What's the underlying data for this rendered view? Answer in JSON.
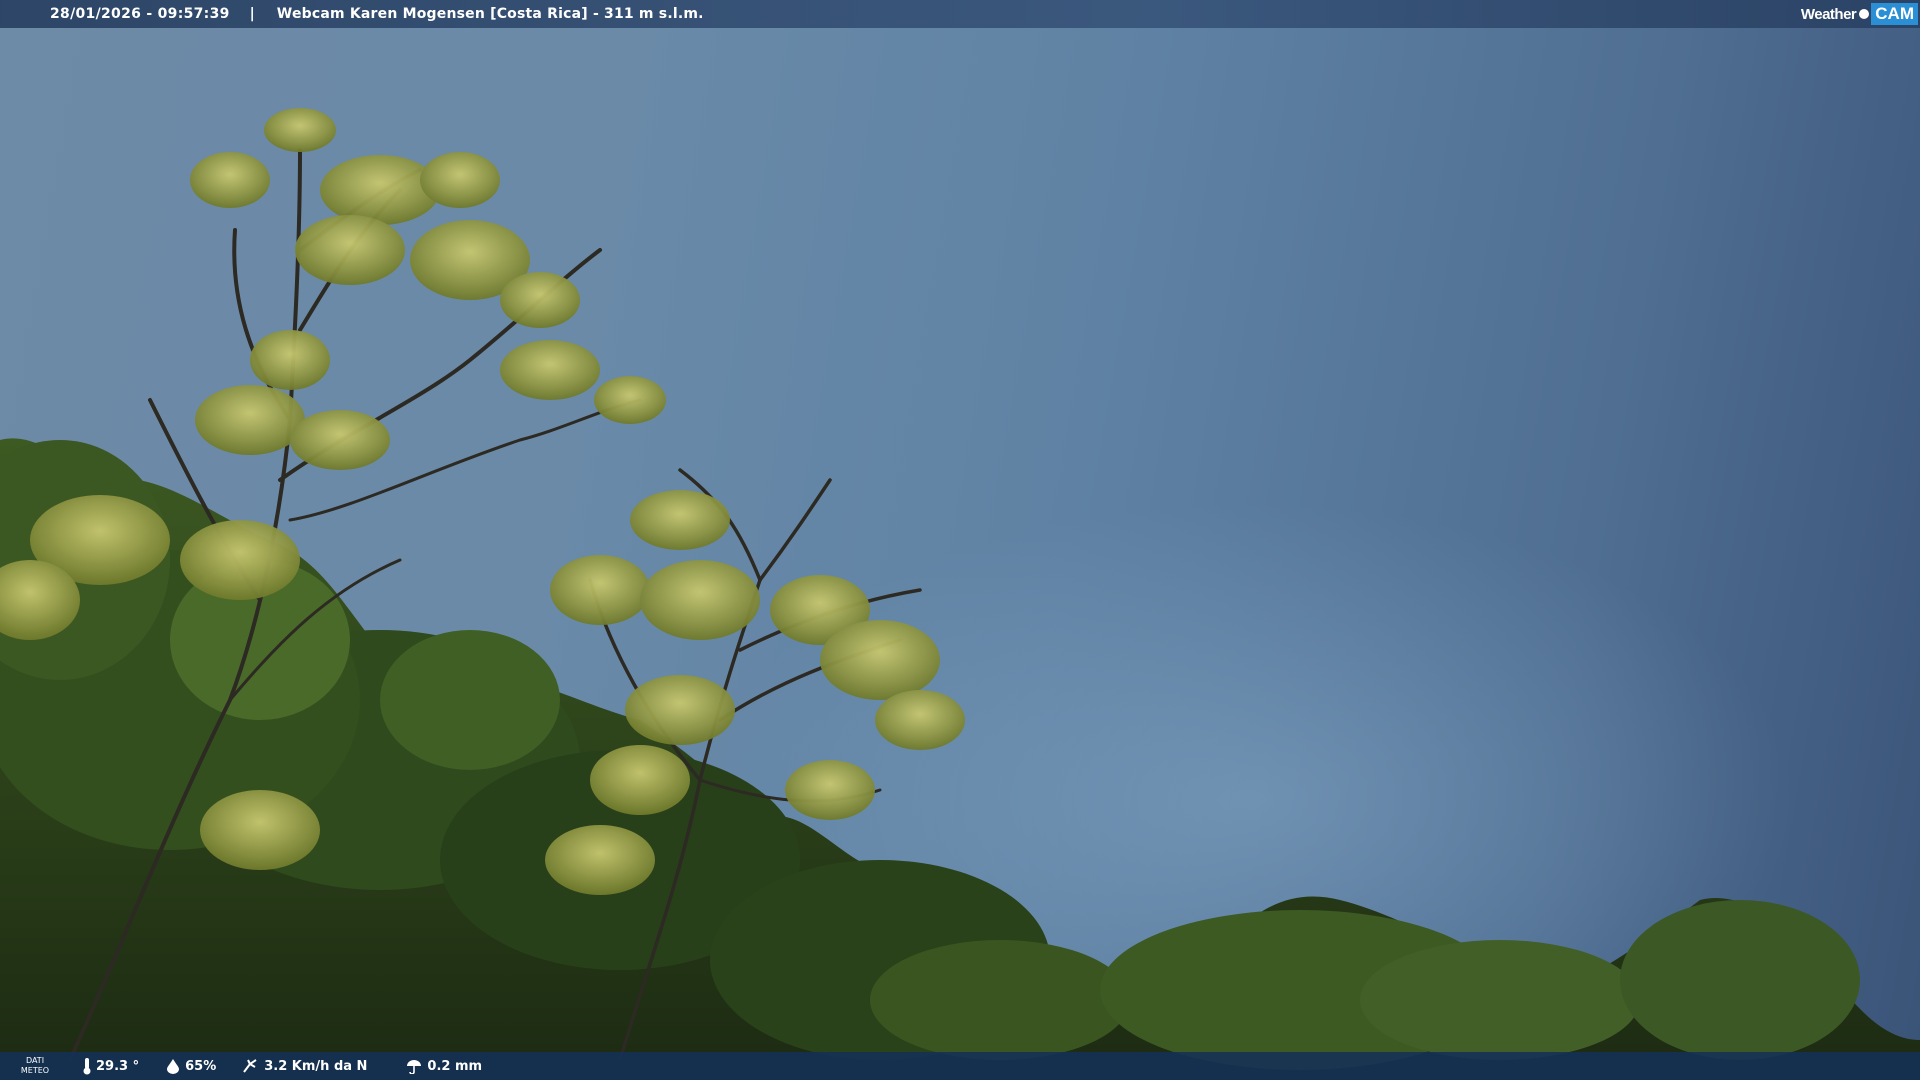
{
  "overlay": {
    "datetime": "28/01/2026 - 09:57:39",
    "separator": "|",
    "location": "Webcam Karen Mogensen [Costa Rica]  - 311 m s.l.m.",
    "logo_word": "Weather",
    "logo_cam": "CAM"
  },
  "weather": {
    "dati_line1": "DATI",
    "dati_line2": "METEO",
    "temperature": "29.3 °",
    "humidity": "65%",
    "wind": "3.2 Km/h da N",
    "rain": "0.2 mm",
    "icons": [
      "thermometer-icon",
      "humidity-drop-icon",
      "wind-icon",
      "rain-icon"
    ]
  },
  "colors": {
    "bar_background": "#284062",
    "cam_badge": "#2b8fd6",
    "text": "#ffffff"
  }
}
